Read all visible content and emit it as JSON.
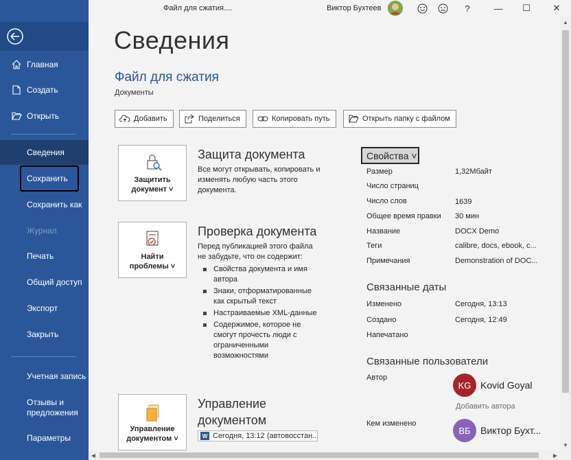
{
  "titlebar": {
    "doc_title": "Файл для сжатия....",
    "user_name": "Виктор Бухтеев",
    "help": "?",
    "minimize": "—",
    "maximize": "☐",
    "close": "✕"
  },
  "sidebar": {
    "items": [
      {
        "label": "Главная",
        "icon": "home-icon"
      },
      {
        "label": "Создать",
        "icon": "new-document-icon"
      },
      {
        "label": "Открыть",
        "icon": "folder-open-icon"
      },
      {
        "label": "Сведения"
      },
      {
        "label": "Сохранить"
      },
      {
        "label": "Сохранить как"
      },
      {
        "label": "Журнал"
      },
      {
        "label": "Печать"
      },
      {
        "label": "Общий доступ"
      },
      {
        "label": "Экспорт"
      },
      {
        "label": "Закрыть"
      },
      {
        "label": "Учетная запись"
      },
      {
        "label": "Отзывы и\nпредложения"
      },
      {
        "label": "Параметры"
      }
    ],
    "accent": "#2b579a"
  },
  "main": {
    "title": "Сведения",
    "file_name": "Файл для сжатия",
    "file_location": "Документы",
    "toolbar": {
      "add": "Добавить",
      "share": "Поделиться",
      "copy_path": "Копировать путь",
      "open_folder": "Открыть папку с файлом"
    },
    "protect": {
      "button_line1": "Защитить",
      "button_line2": "документ ˅",
      "title": "Защита документа",
      "text": "Все могут открывать, копировать и изменять любую часть этого документа."
    },
    "inspect": {
      "button_line1": "Найти",
      "button_line2": "проблемы ˅",
      "title": "Проверка документа",
      "text": "Перед публикацией этого файла не забудьте, что он содержит:",
      "bullets": [
        "Свойства документа и имя автора",
        "Знаки, отформатированные как скрытый текст",
        "Настраиваемые XML-данные",
        "Содержимое, которое не смогут прочесть люди с ограниченными возможностями"
      ]
    },
    "manage": {
      "button_line1": "Управление",
      "button_line2": "документом ˅",
      "title_line1": "Управление",
      "title_line2": "документом",
      "version": "Сегодня, 13:12 (автовосстан..."
    }
  },
  "properties": {
    "button": "Свойства ˅",
    "rows": [
      {
        "label": "Размер",
        "value": "1,32Мбайт"
      },
      {
        "label": "Число страниц",
        "value": ""
      },
      {
        "label": "Число слов",
        "value": "1639"
      },
      {
        "label": "Общее время правки",
        "value": "30 мин"
      },
      {
        "label": "Название",
        "value": "DOCX Demo"
      },
      {
        "label": "Теги",
        "value": "calibre, docs, ebook, c..."
      },
      {
        "label": "Примечания",
        "value": "Demonstration of DOC..."
      }
    ],
    "dates_title": "Связанные даты",
    "dates": [
      {
        "label": "Изменено",
        "value": "Сегодня, 13:13"
      },
      {
        "label": "Создано",
        "value": "Сегодня, 12:49"
      },
      {
        "label": "Напечатано",
        "value": ""
      }
    ],
    "users_title": "Связанные пользователи",
    "author_label": "Автор",
    "author": {
      "initials": "KG",
      "name": "Kovid Goyal",
      "color": "#a4262c"
    },
    "add_author": "Добавить автора",
    "modified_by_label": "Кем изменено",
    "modifier": {
      "initials": "ВБ",
      "name": "Виктор Бухт...",
      "color": "#8764b8"
    }
  }
}
